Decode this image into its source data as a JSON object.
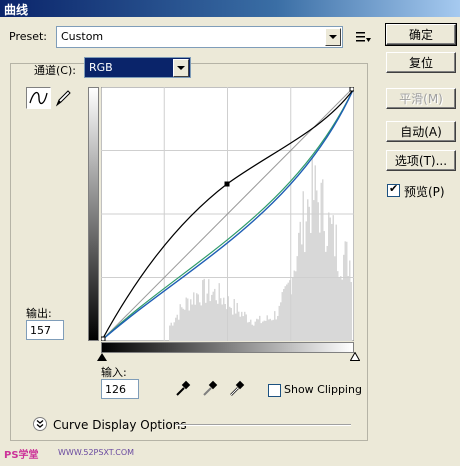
{
  "window": {
    "title": "曲线"
  },
  "preset": {
    "label": "Preset:",
    "value": "Custom"
  },
  "channel": {
    "label": "通道(C):",
    "value": "RGB"
  },
  "output": {
    "label": "输出:",
    "value": "157"
  },
  "input": {
    "label": "输入:",
    "value": "126"
  },
  "show_clipping": {
    "label": "Show Clipping",
    "checked": false
  },
  "curve_display_options": {
    "label": "Curve Display Options"
  },
  "buttons": {
    "ok": "确定",
    "reset": "复位",
    "smooth": "平滑(M)",
    "auto": "自动(A)",
    "options": "选项(T)..."
  },
  "preview": {
    "label": "预览(P)",
    "checked": true
  },
  "watermark": {
    "left": "PS学堂",
    "site": "WWW.52PSXT.COM"
  },
  "colors": {
    "title_gradient_start": "#0a246a",
    "selection": "#0a246a",
    "curve_line": "#1f5fb5",
    "histogram": "#d8d8d8"
  },
  "icons": [
    "preset-menu-icon",
    "curve-tool-icon",
    "pencil-tool-icon",
    "black-eyedropper-icon",
    "gray-eyedropper-icon",
    "white-eyedropper-icon",
    "expand-chevron-icon"
  ]
}
